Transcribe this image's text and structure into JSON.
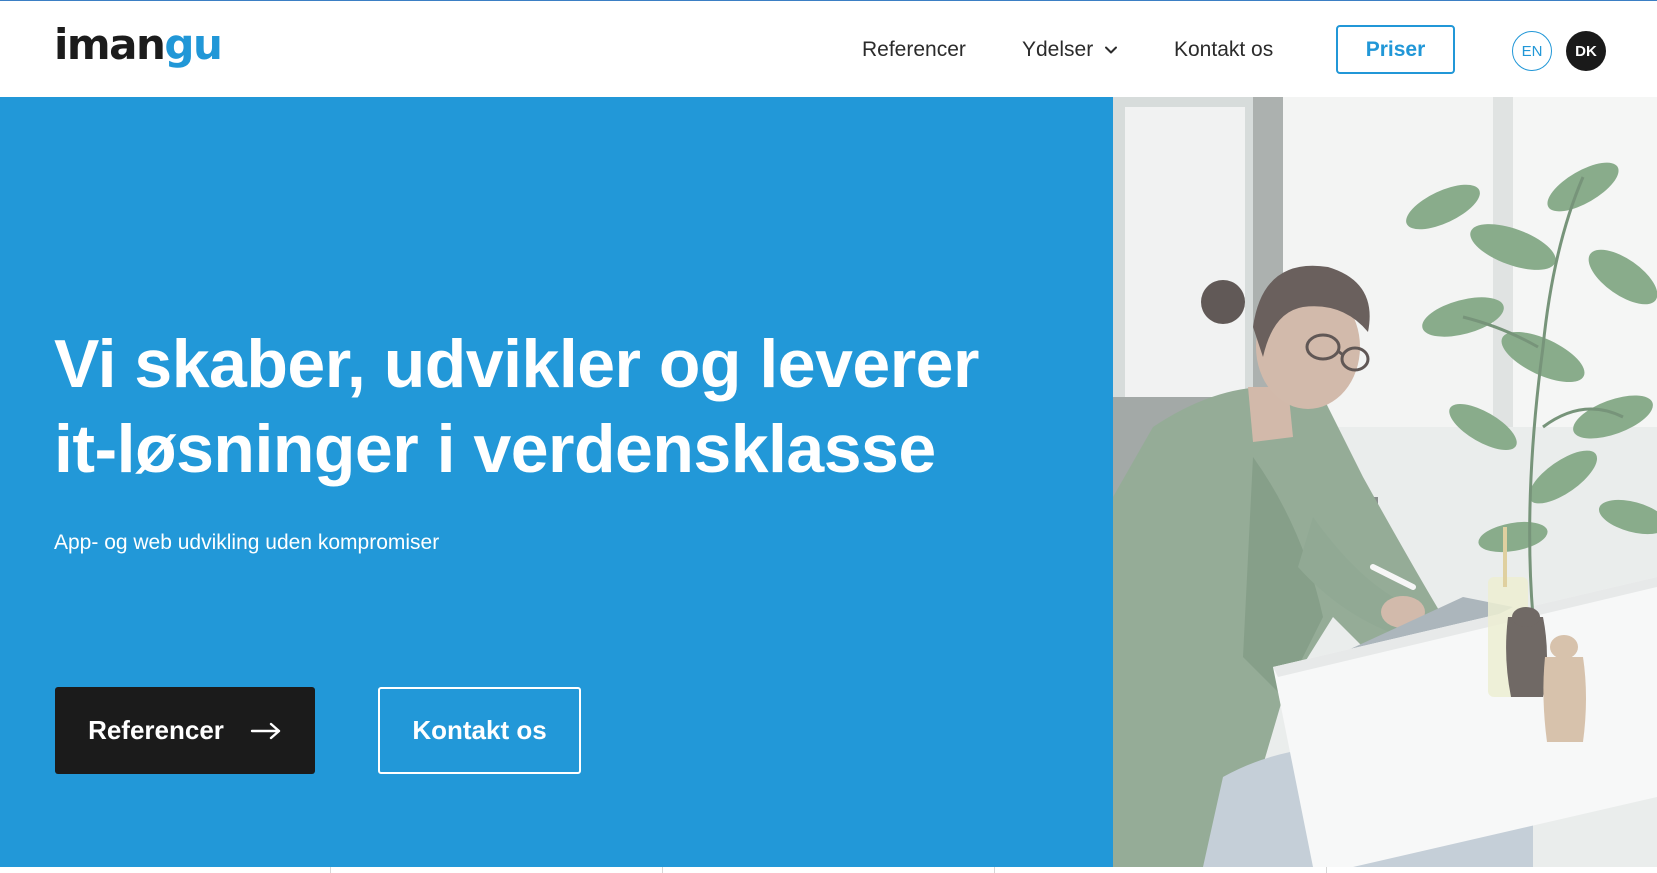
{
  "header": {
    "logo_part1": "iman",
    "logo_part2": "gu",
    "nav": {
      "referencer": "Referencer",
      "ydelser": "Ydelser",
      "kontakt": "Kontakt os"
    },
    "priser_label": "Priser",
    "lang_en": "EN",
    "lang_dk": "DK"
  },
  "hero": {
    "headline_line1": "Vi skaber, udvikler og leverer",
    "headline_line2": "it-løsninger i verdensklasse",
    "subline": "App- og web udvikling uden kompromiser",
    "primary_button": "Referencer",
    "secondary_button": "Kontakt os"
  },
  "colors": {
    "brand_blue": "#2298d8",
    "dark": "#1b1b1b",
    "white": "#ffffff"
  },
  "icons": {
    "dropdown": "chevron-down-icon",
    "arrow": "arrow-right-icon"
  }
}
